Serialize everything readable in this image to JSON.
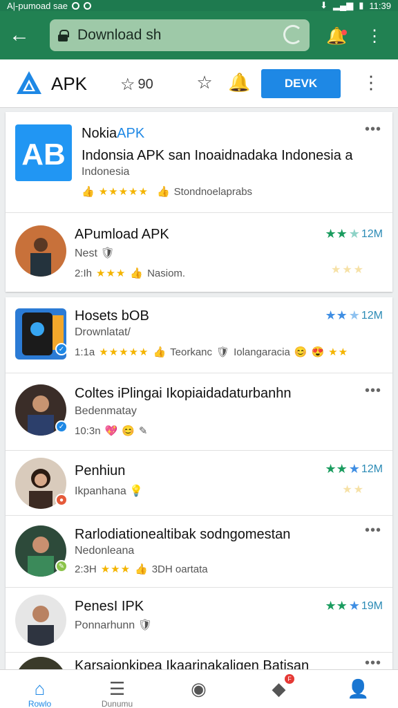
{
  "status": {
    "left": "A|-pumoad sae",
    "right": "11:39"
  },
  "browser": {
    "url": "Download sh"
  },
  "app": {
    "name": "APK",
    "rating": "90",
    "action": "DEVK"
  },
  "featured": {
    "title_prefix": "Nokia",
    "title_accent": "APK",
    "description": "Indonsia APK san Inoaidnadaka Indonesia a",
    "subtitle": "Indonesia",
    "meta": "Stondnoelaprabs"
  },
  "item1": {
    "title": "APumload APK",
    "sub": "Nest",
    "meta": "Nasiom.",
    "count": "2:Ih",
    "right": "12M"
  },
  "list": [
    {
      "title": "Hosets bOB",
      "sub": "Drownlatat/",
      "count": "1:1a",
      "meta1": "Teorkanc",
      "meta2": "Iolangaracia",
      "right": "12M"
    },
    {
      "title": "Coltes iPlingai Ikopiaidadaturbanhn",
      "sub": "Bedenmatay",
      "count": "10:3n"
    },
    {
      "title": "Penhiun",
      "sub": "Ikpanhana",
      "right": "12M"
    },
    {
      "title": "Rarlodiationealtibak sodngomestan",
      "sub": "Nedonleana",
      "count": "2:3H",
      "meta": "3DH oartata"
    },
    {
      "title": "PenesI IPK",
      "sub": "Ponnarhunn",
      "right": "19M"
    },
    {
      "title": "Karsaionkipea Ikaarinakaligen Batisan"
    }
  ],
  "nav": {
    "home": "Rowlo",
    "second": "Dunumu",
    "badge": "F"
  },
  "colors": {
    "topbar": "#218152",
    "accent": "#1e88e5",
    "star_green": "#1a9c5f",
    "star_blue": "#3f8ee3",
    "gold": "#f4b400"
  },
  "icons": [
    "back-arrow-icon",
    "lock-icon",
    "reload-icon",
    "bell-icon",
    "more-vert-icon",
    "star-icon",
    "bell-outline-icon",
    "home-icon",
    "list-icon",
    "circle-icon",
    "tag-icon",
    "person-icon"
  ]
}
